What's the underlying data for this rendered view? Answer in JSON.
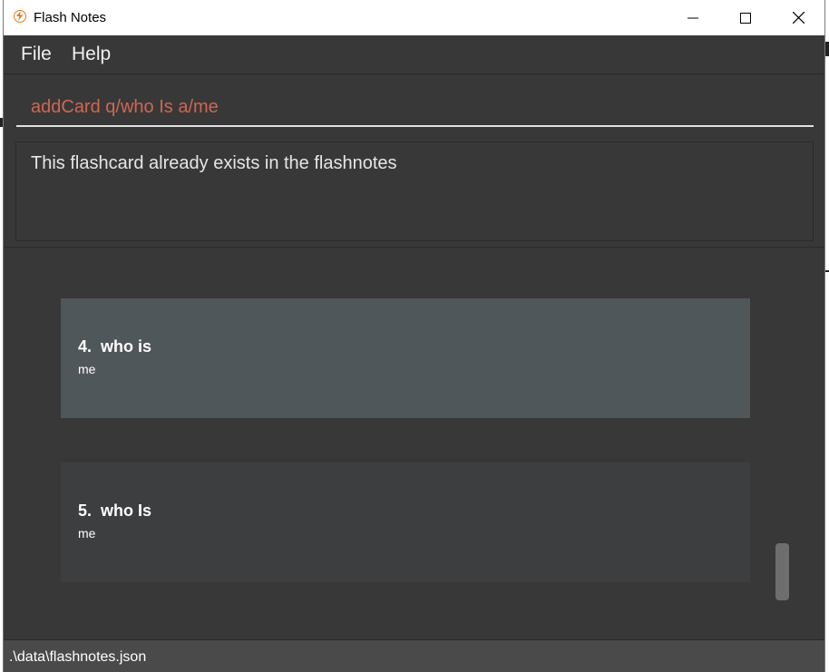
{
  "window": {
    "title": "Flash Notes",
    "icon": "lightning-icon",
    "controls": [
      "minimize-icon",
      "maximize-icon",
      "close-icon"
    ]
  },
  "menu": {
    "items": [
      {
        "label": "File"
      },
      {
        "label": "Help"
      }
    ]
  },
  "command": {
    "value": "addCard q/who Is a/me",
    "text_color": "#d06651"
  },
  "result": {
    "message": "This flashcard already exists in the flashnotes"
  },
  "cards": [
    {
      "index": "4.",
      "question": "who is",
      "answer": "me",
      "selected": true
    },
    {
      "index": "5.",
      "question": "who Is",
      "answer": "me",
      "selected": false
    }
  ],
  "status": {
    "path": ".\\data\\flashnotes.json"
  },
  "colors": {
    "background": "#383838",
    "selected_card": "#50575a",
    "card": "#3d3e40",
    "status_bar": "#4a4a4a"
  }
}
